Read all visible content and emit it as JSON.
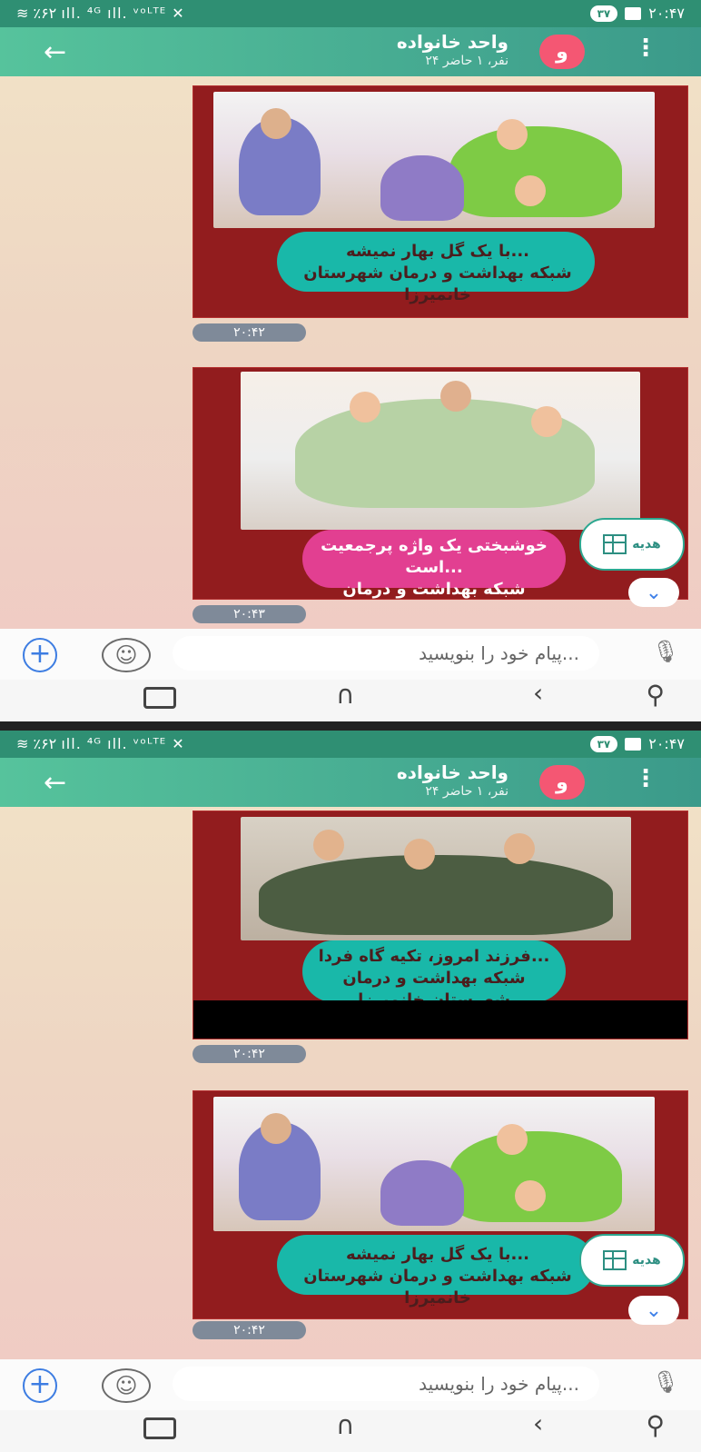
{
  "screens": [
    {
      "status_left": "≋ ٪۶۲ ıll. ⁴ᴳ ıll. ᵛᵒᴸᵀᴱ ✕",
      "status_right": "۲۰:۴۷",
      "header": {
        "title": "واحد خانواده",
        "subtitle": "۲۴ نفر، ۱ حاضر",
        "avatar": "و",
        "back_icon": "←",
        "menu_icon": "⋮"
      },
      "messages": [
        {
          "time": "۲۰:۴۲",
          "caption_line1": "با یک گل بهار نمیشه...",
          "caption_line2": "شبکه بهداشت و درمان شهرستان خانمیرزا"
        },
        {
          "time": "۲۰:۴۳",
          "caption_line1": "خوشبختی یک واژه پرجمعیت است...",
          "caption_line2": "شبکه بهداشت و درمان شهرستان خانمیرزا"
        }
      ],
      "gift_text": "هدیه",
      "input_placeholder": "پیام خود را بنویسید...",
      "nav": {
        "home": "▭",
        "back": "‹",
        "recent": "∩",
        "accessibility": "⚲"
      }
    },
    {
      "status_left": "≋ ٪۶۲ ıll. ⁴ᴳ ıll. ᵛᵒᴸᵀᴱ ✕",
      "status_right": "۲۰:۴۷",
      "header": {
        "title": "واحد خانواده",
        "subtitle": "۲۴ نفر، ۱ حاضر",
        "avatar": "و",
        "back_icon": "←",
        "menu_icon": "⋮"
      },
      "messages": [
        {
          "time": "۲۰:۴۲",
          "caption_line1": "فرزند امروز، تکیه گاه فردا...",
          "caption_line2": "شبکه بهداشت و درمان شهرستان خانمیرزا"
        },
        {
          "time": "۲۰:۴۲",
          "caption_line1": "با یک گل بهار نمیشه...",
          "caption_line2": "شبکه بهداشت و درمان شهرستان خانمیرزا"
        }
      ],
      "gift_text": "هدیه",
      "input_placeholder": "پیام خود را بنویسید...",
      "nav": {
        "home": "▭",
        "back": "‹",
        "recent": "∩",
        "accessibility": "⚲"
      }
    }
  ],
  "colors": {
    "header": "#3b9a8a",
    "status": "#2f8f73",
    "avatar": "#f45773",
    "message": "#921c1e",
    "caption": "#19b8a9",
    "pink_caption": "#e23f91",
    "link": "#3d7de2"
  }
}
